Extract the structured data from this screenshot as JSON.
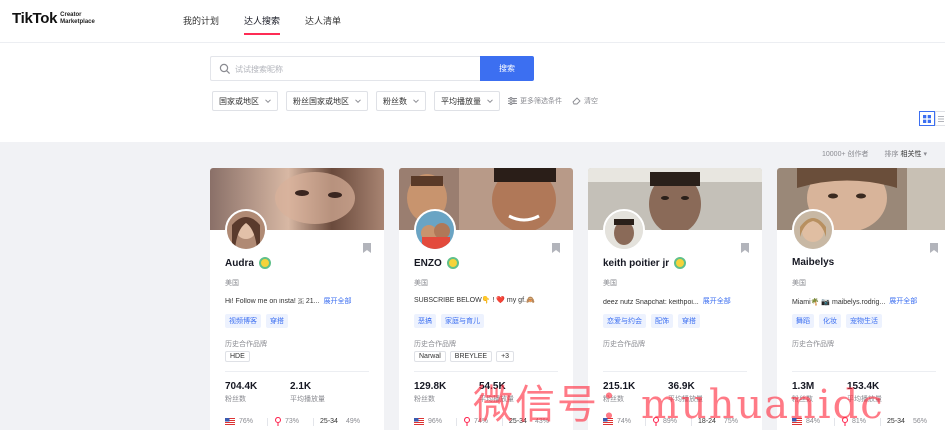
{
  "header": {
    "logo": "TikTok",
    "logo_sub_line1": "Creator",
    "logo_sub_line2": "Marketplace",
    "nav": [
      "我的计划",
      "达人搜索",
      "达人清单"
    ]
  },
  "search": {
    "placeholder": "试试搜索昵称",
    "button": "搜索",
    "filters": [
      "国家或地区",
      "粉丝国家或地区",
      "粉丝数",
      "平均播放量"
    ],
    "more_filters": "更多筛选条件",
    "clear": "清空"
  },
  "results": {
    "count": "10000+ 创作者",
    "sort_label": "排序",
    "sort_value": "相关性"
  },
  "cards": [
    {
      "name": "Audra",
      "country": "美国",
      "bio": "Hi! Follow me on insta! 🇸 21...",
      "more": "展开全部",
      "tags": [
        "视频博客",
        "穿搭"
      ],
      "brands_label": "历史合作品牌",
      "brands": [
        "HDE"
      ],
      "followers": "704.4K",
      "followers_label": "粉丝数",
      "avg_views": "2.1K",
      "avg_views_label": "平均播放量",
      "country_pct": "76%",
      "gender_pct": "73%",
      "age": "25-34",
      "age_pct": "49%"
    },
    {
      "name": "ENZO",
      "country": "美国",
      "bio": "SUBSCRIBE BELOW👇 ! ❤️ my gf.🙈",
      "more": "",
      "tags": [
        "恶搞",
        "家庭与育儿"
      ],
      "brands_label": "历史合作品牌",
      "brands": [
        "Narwal",
        "BREYLEE",
        "+3"
      ],
      "followers": "129.8K",
      "followers_label": "粉丝数",
      "avg_views": "54.5K",
      "avg_views_label": "平均播放量",
      "country_pct": "96%",
      "gender_pct": "74%",
      "age": "25-34",
      "age_pct": "43%"
    },
    {
      "name": "keith poitier jr",
      "country": "美国",
      "bio": "deez nutz Snapchat: keithpoi...",
      "more": "展开全部",
      "tags": [
        "恋爱与约会",
        "配饰",
        "穿搭"
      ],
      "brands_label": "历史合作品牌",
      "brands": [],
      "followers": "215.1K",
      "followers_label": "粉丝数",
      "avg_views": "36.9K",
      "avg_views_label": "平均播放量",
      "country_pct": "74%",
      "gender_pct": "89%",
      "age": "18-24",
      "age_pct": "75%"
    },
    {
      "name": "Maibelys",
      "country": "美国",
      "bio": "Miami🌴 📷 maibelys.rodrig...",
      "more": "展开全部",
      "tags": [
        "舞蹈",
        "化妆",
        "宠物生活"
      ],
      "brands_label": "历史合作品牌",
      "brands": [],
      "followers": "1.3M",
      "followers_label": "粉丝数",
      "avg_views": "153.4K",
      "avg_views_label": "平均播放量",
      "country_pct": "84%",
      "gender_pct": "81%",
      "age": "25-34",
      "age_pct": "56%"
    }
  ],
  "watermark": "微信号：muhuanidc",
  "colors": {
    "accent": "#3c6ff1",
    "nav_underline": "#fe2c55",
    "background": "#f1f2f5"
  }
}
